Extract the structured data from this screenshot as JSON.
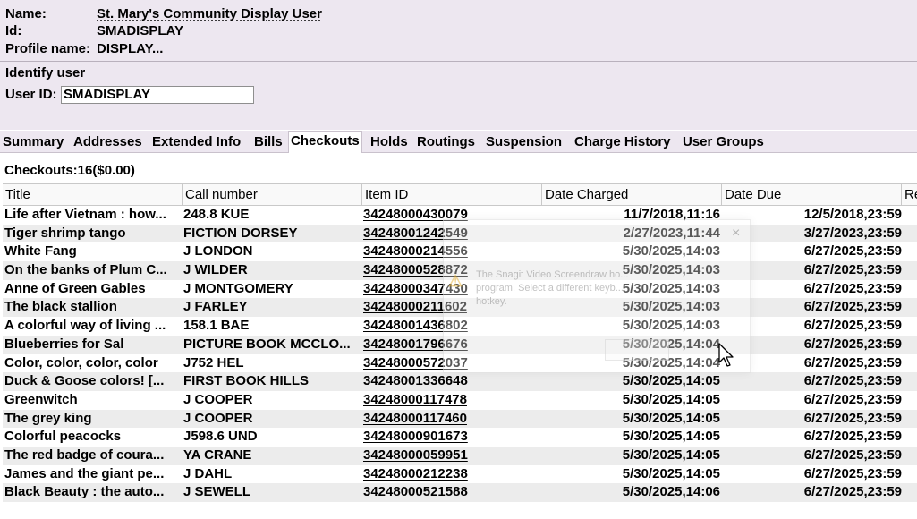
{
  "patron": {
    "name_label": "Name:",
    "name_value": "St. Mary's Community Display User",
    "id_label": "Id:",
    "id_value": "SMADISPLAY",
    "profile_label": "Profile name:",
    "profile_value": "DISPLAY..."
  },
  "identify": {
    "title": "Identify user",
    "userid_label": "User ID:",
    "userid_value": "SMADISPLAY"
  },
  "tabs": [
    {
      "label": "Summary"
    },
    {
      "label": "Addresses"
    },
    {
      "label": "Extended Info"
    },
    {
      "label": "Bills"
    },
    {
      "label": "Checkouts",
      "active": true
    },
    {
      "label": "Holds"
    },
    {
      "label": "Routings"
    },
    {
      "label": "Suspension"
    },
    {
      "label": "Charge History"
    },
    {
      "label": "User Groups"
    }
  ],
  "checkouts_summary": "Checkouts:16($0.00)",
  "table": {
    "columns": [
      "Title",
      "Call number",
      "Item ID",
      "Date Charged",
      "Date Due",
      "Re"
    ],
    "rows": [
      [
        "Life after Vietnam : how...",
        "248.8 KUE",
        "34248000430079",
        "11/7/2018,11:16",
        "12/5/2018,23:59"
      ],
      [
        "Tiger shrimp tango",
        "FICTION DORSEY",
        "34248001242549",
        "2/27/2023,11:44",
        "3/27/2023,23:59"
      ],
      [
        "White Fang",
        "J LONDON",
        "34248000214556",
        "5/30/2025,14:03",
        "6/27/2025,23:59"
      ],
      [
        "On the banks of Plum C...",
        "J WILDER",
        "34248000528872",
        "5/30/2025,14:03",
        "6/27/2025,23:59"
      ],
      [
        "Anne of Green Gables",
        "J MONTGOMERY",
        "34248000347430",
        "5/30/2025,14:03",
        "6/27/2025,23:59"
      ],
      [
        "The black stallion",
        "J FARLEY",
        "34248000211602",
        "5/30/2025,14:03",
        "6/27/2025,23:59"
      ],
      [
        "A colorful way of living ...",
        "158.1 BAE",
        "34248001436802",
        "5/30/2025,14:03",
        "6/27/2025,23:59"
      ],
      [
        "Blueberries for Sal",
        "PICTURE BOOK MCCLO...",
        "34248001796676",
        "5/30/2025,14:04",
        "6/27/2025,23:59"
      ],
      [
        "Color, color, color, color",
        "J752 HEL",
        "34248000572037",
        "5/30/2025,14:04",
        "6/27/2025,23:59"
      ],
      [
        "Duck & Goose colors! [...",
        "FIRST BOOK HILLS",
        "34248001336648",
        "5/30/2025,14:05",
        "6/27/2025,23:59"
      ],
      [
        "Greenwitch",
        "J COOPER",
        "34248000117478",
        "5/30/2025,14:05",
        "6/27/2025,23:59"
      ],
      [
        "The grey king",
        "J COOPER",
        "34248000117460",
        "5/30/2025,14:05",
        "6/27/2025,23:59"
      ],
      [
        "Colorful peacocks",
        "J598.6 UND",
        "34248000901673",
        "5/30/2025,14:05",
        "6/27/2025,23:59"
      ],
      [
        "The red badge of coura...",
        "YA CRANE",
        "34248000059951",
        "5/30/2025,14:05",
        "6/27/2025,23:59"
      ],
      [
        "James and the giant pe...",
        "J DAHL",
        "34248000212238",
        "5/30/2025,14:05",
        "6/27/2025,23:59"
      ],
      [
        "Black Beauty : the auto...",
        "J SEWELL",
        "34248000521588",
        "5/30/2025,14:06",
        "6/27/2025,23:59"
      ]
    ]
  },
  "overlay": {
    "message": "The Snagit Video Screendraw ho... program. Select a different keyb... hotkey.",
    "close_glyph": "×",
    "warning_icon": "warning-icon"
  }
}
